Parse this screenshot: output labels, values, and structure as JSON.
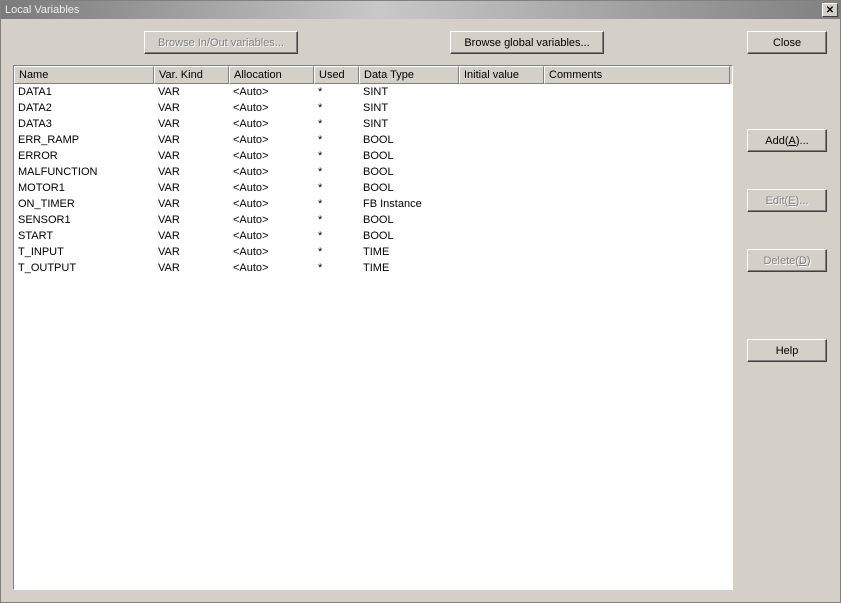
{
  "window": {
    "title": "Local Variables"
  },
  "buttons": {
    "browse_io": "Browse In/Out variables...",
    "browse_global": "Browse global variables...",
    "close": "Close",
    "add_pre": "Add(",
    "add_key": "A",
    "add_post": ")...",
    "edit_pre": "Edit(",
    "edit_key": "E",
    "edit_post": ")...",
    "delete_pre": "Delete(",
    "delete_key": "D",
    "delete_post": ")",
    "help": "Help"
  },
  "columns": {
    "name": "Name",
    "kind": "Var. Kind",
    "alloc": "Allocation",
    "used": "Used",
    "type": "Data Type",
    "init": "Initial value",
    "comm": "Comments"
  },
  "rows": [
    {
      "name": "DATA1",
      "kind": "VAR",
      "alloc": "<Auto>",
      "used": "*",
      "type": "SINT",
      "init": "",
      "comm": ""
    },
    {
      "name": "DATA2",
      "kind": "VAR",
      "alloc": "<Auto>",
      "used": "*",
      "type": "SINT",
      "init": "",
      "comm": ""
    },
    {
      "name": "DATA3",
      "kind": "VAR",
      "alloc": "<Auto>",
      "used": "*",
      "type": "SINT",
      "init": "",
      "comm": ""
    },
    {
      "name": "ERR_RAMP",
      "kind": "VAR",
      "alloc": "<Auto>",
      "used": "*",
      "type": "BOOL",
      "init": "",
      "comm": ""
    },
    {
      "name": "ERROR",
      "kind": "VAR",
      "alloc": "<Auto>",
      "used": "*",
      "type": "BOOL",
      "init": "",
      "comm": ""
    },
    {
      "name": "MALFUNCTION",
      "kind": "VAR",
      "alloc": "<Auto>",
      "used": "*",
      "type": "BOOL",
      "init": "",
      "comm": ""
    },
    {
      "name": "MOTOR1",
      "kind": "VAR",
      "alloc": "<Auto>",
      "used": "*",
      "type": "BOOL",
      "init": "",
      "comm": ""
    },
    {
      "name": "ON_TIMER",
      "kind": "VAR",
      "alloc": "<Auto>",
      "used": "*",
      "type": "FB Instance",
      "init": "",
      "comm": ""
    },
    {
      "name": "SENSOR1",
      "kind": "VAR",
      "alloc": "<Auto>",
      "used": "*",
      "type": "BOOL",
      "init": "",
      "comm": ""
    },
    {
      "name": "START",
      "kind": "VAR",
      "alloc": "<Auto>",
      "used": "*",
      "type": "BOOL",
      "init": "",
      "comm": ""
    },
    {
      "name": "T_INPUT",
      "kind": "VAR",
      "alloc": "<Auto>",
      "used": "*",
      "type": "TIME",
      "init": "",
      "comm": ""
    },
    {
      "name": "T_OUTPUT",
      "kind": "VAR",
      "alloc": "<Auto>",
      "used": "*",
      "type": "TIME",
      "init": "",
      "comm": ""
    }
  ]
}
